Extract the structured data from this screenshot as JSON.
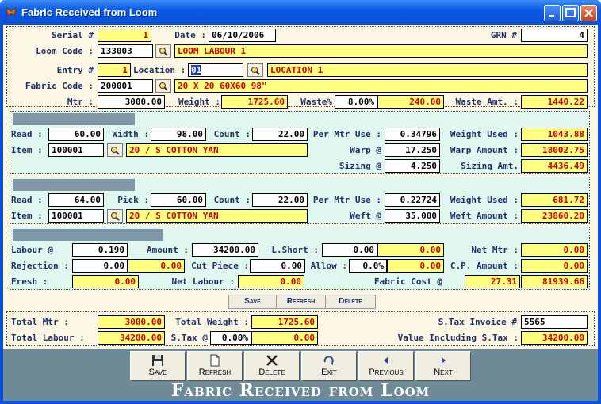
{
  "window": {
    "title": "Fabric Received from Loom"
  },
  "header": {
    "serial_label": "Serial #",
    "serial": "1",
    "date_label": "Date :",
    "date": "06/10/2006",
    "grn_label": "GRN #",
    "grn": "4",
    "loom_code_label": "Loom Code :",
    "loom_code": "133003",
    "loom_name": "LOOM LABOUR 1",
    "entry_label": "Entry #",
    "entry": "1",
    "location_label": "Location :",
    "location_code": "01",
    "location_name": "LOCATION 1",
    "fabric_code_label": "Fabric Code :",
    "fabric_code": "200001",
    "fabric_name": "20 X 20 60X60 98\"",
    "mtr_label": "Mtr :",
    "mtr": "3000.00",
    "weight_label": "Weight :",
    "weight": "1725.60",
    "waste_pct_label": "Waste%",
    "waste_pct": "8.00%",
    "waste_val": "240.00",
    "waste_amt_label": "Waste Amt. :",
    "waste_amt": "1440.22"
  },
  "warp": {
    "read_label": "Read :",
    "read": "60.00",
    "width_label": "Width :",
    "width": "98.00",
    "count_label": "Count :",
    "count": "22.00",
    "per_mtr_label": "Per Mtr Use :",
    "per_mtr": "0.34796",
    "weight_used_label": "Weight Used :",
    "weight_used": "1043.88",
    "item_label": "Item :",
    "item_code": "100001",
    "item_name": "20 / S COTTON YAN",
    "warp_at_label": "Warp @",
    "warp_at": "17.250",
    "warp_amount_label": "Warp Amount :",
    "warp_amount": "18002.75",
    "sizing_at_label": "Sizing @",
    "sizing_at": "4.250",
    "sizing_amt_label": "Sizing Amt.",
    "sizing_amt": "4436.49"
  },
  "weft": {
    "read_label": "Read :",
    "read": "64.00",
    "pick_label": "Pick :",
    "pick": "60.00",
    "count_label": "Count :",
    "count": "22.00",
    "per_mtr_label": "Per Mtr Use :",
    "per_mtr": "0.22724",
    "weight_used_label": "Weight Used :",
    "weight_used": "681.72",
    "item_label": "Item :",
    "item_code": "100001",
    "item_name": "20 / S COTTON YAN",
    "weft_at_label": "Weft @",
    "weft_at": "35.000",
    "weft_amount_label": "Weft Amount :",
    "weft_amount": "23860.20"
  },
  "labour": {
    "labour_at_label": "Labour @",
    "labour_at": "0.190",
    "amount_label": "Amount :",
    "amount": "34200.00",
    "lshort_label": "L.Short :",
    "lshort": "0.00",
    "lshort_val": "0.00",
    "net_mtr_label": "Net Mtr :",
    "net_mtr": "0.00",
    "rejection_label": "Rejection :",
    "rejection": "0.00",
    "rejection_val": "0.00",
    "cut_piece_label": "Cut Piece :",
    "cut_piece": "0.00",
    "allow_label": "Allow :",
    "allow_pct": "0.0%",
    "allow_val": "0.00",
    "cp_amount_label": "C.P. Amount :",
    "cp_amount": "0.00",
    "fresh_label": "Fresh :",
    "fresh": "0.00",
    "net_labour_label": "Net Labour :",
    "net_labour": "0.00",
    "fabric_cost_label": "Fabric Cost @",
    "fabric_cost_rate": "27.31",
    "fabric_cost": "81939.66"
  },
  "grid_buttons": {
    "save": "Save",
    "refresh": "Refresh",
    "delete": "Delete"
  },
  "totals": {
    "total_mtr_label": "Total Mtr :",
    "total_mtr": "3000.00",
    "total_weight_label": "Total Weight :",
    "total_weight": "1725.60",
    "stax_invoice_label": "S.Tax Invoice #",
    "stax_invoice": "5565",
    "total_labour_label": "Total Labour :",
    "total_labour": "34200.00",
    "stax_label": "S.Tax @",
    "stax_pct": "0.00%",
    "stax_val": "0.00",
    "value_incl_label": "Value Including S.Tax :",
    "value_incl": "34200.00"
  },
  "toolbar": {
    "save": "Save",
    "refresh": "Refresh",
    "delete": "Delete",
    "exit": "Exit",
    "previous": "Previous",
    "next": "Next"
  },
  "footer_title": "Fabric Received from Loom"
}
